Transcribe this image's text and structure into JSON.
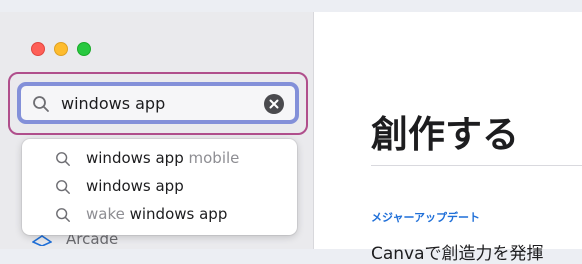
{
  "window": {
    "traffic_lights": [
      "close",
      "minimize",
      "zoom"
    ]
  },
  "search": {
    "value": "windows app",
    "placeholder": "",
    "icons": {
      "search": "magnifier-icon",
      "clear": "clear-x-circle-icon"
    }
  },
  "suggestions": [
    {
      "prefix": "",
      "bold": "windows app",
      "suffix": " mobile"
    },
    {
      "prefix": "",
      "bold": "windows app",
      "suffix": ""
    },
    {
      "prefix": "wake ",
      "bold": "windows app",
      "suffix": ""
    }
  ],
  "sidebar": {
    "partial_item_label": "Arcade"
  },
  "main": {
    "title": "創作する",
    "section_kicker": "メジャーアップデート",
    "card_title": "Canvaで創造力を発揮"
  },
  "colors": {
    "focus_ring": "#8390d9",
    "annotation_frame": "#b04f8c",
    "kicker": "#1f6fd8"
  }
}
